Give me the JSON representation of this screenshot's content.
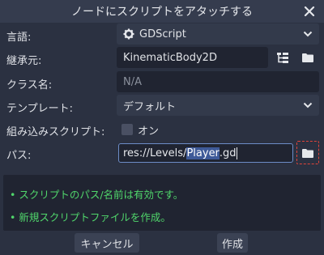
{
  "dialog": {
    "title": "ノードにスクリプトをアタッチする"
  },
  "form": {
    "language": {
      "label": "言語:",
      "value": "GDScript",
      "icon": "gear-icon"
    },
    "inherits": {
      "label": "継承元:",
      "value": "KinematicBody2D"
    },
    "class_name": {
      "label": "クラス名:",
      "value": "N/A"
    },
    "template": {
      "label": "テンプレート:",
      "value": "デフォルト"
    },
    "builtin": {
      "label": "組み込みスクリプト:",
      "checkbox_label": "オン",
      "checked": false
    },
    "path": {
      "label": "パス:",
      "prefix": "res://Levels/",
      "selected": "Player",
      "suffix": ".gd"
    }
  },
  "status": {
    "messages": [
      "• スクリプトのパス/名前は有効です。",
      "• 新規スクリプトファイルを作成。"
    ],
    "color": "#50d66b"
  },
  "buttons": {
    "cancel": "キャンセル",
    "create": "作成"
  },
  "colors": {
    "background": "#2b3141",
    "field": "#202431",
    "accent_highlight": "#e0443a"
  }
}
